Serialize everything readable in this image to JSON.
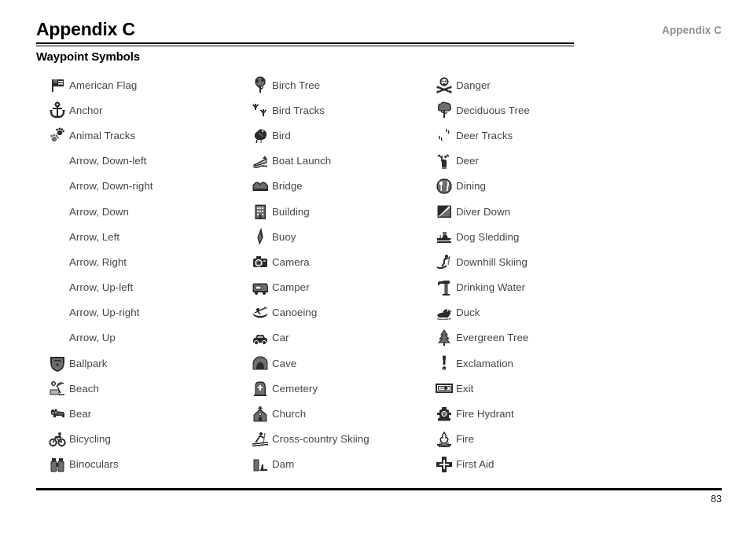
{
  "header": {
    "title": "Appendix C",
    "right_label": "Appendix C",
    "subheading": "Waypoint Symbols"
  },
  "footer": {
    "page_number": "83"
  },
  "columns": [
    {
      "items": [
        {
          "label": "American Flag",
          "icon": "american-flag-icon"
        },
        {
          "label": "Anchor",
          "icon": "anchor-icon"
        },
        {
          "label": "Animal Tracks",
          "icon": "animal-tracks-icon"
        },
        {
          "label": "Arrow, Down-left",
          "icon": "arrow-down-left-icon"
        },
        {
          "label": "Arrow, Down-right",
          "icon": "arrow-down-right-icon"
        },
        {
          "label": "Arrow, Down",
          "icon": "arrow-down-icon"
        },
        {
          "label": "Arrow, Left",
          "icon": "arrow-left-icon"
        },
        {
          "label": "Arrow, Right",
          "icon": "arrow-right-icon"
        },
        {
          "label": "Arrow, Up-left",
          "icon": "arrow-up-left-icon"
        },
        {
          "label": "Arrow, Up-right",
          "icon": "arrow-up-right-icon"
        },
        {
          "label": "Arrow, Up",
          "icon": "arrow-up-icon"
        },
        {
          "label": "Ballpark",
          "icon": "ballpark-icon"
        },
        {
          "label": "Beach",
          "icon": "beach-icon"
        },
        {
          "label": "Bear",
          "icon": "bear-icon"
        },
        {
          "label": "Bicycling",
          "icon": "bicycling-icon"
        },
        {
          "label": "Binoculars",
          "icon": "binoculars-icon"
        }
      ]
    },
    {
      "items": [
        {
          "label": "Birch Tree",
          "icon": "birch-tree-icon"
        },
        {
          "label": "Bird Tracks",
          "icon": "bird-tracks-icon"
        },
        {
          "label": "Bird",
          "icon": "bird-icon"
        },
        {
          "label": "Boat Launch",
          "icon": "boat-launch-icon"
        },
        {
          "label": "Bridge",
          "icon": "bridge-icon"
        },
        {
          "label": "Building",
          "icon": "building-icon"
        },
        {
          "label": "Buoy",
          "icon": "buoy-icon"
        },
        {
          "label": "Camera",
          "icon": "camera-icon"
        },
        {
          "label": "Camper",
          "icon": "camper-icon"
        },
        {
          "label": "Canoeing",
          "icon": "canoeing-icon"
        },
        {
          "label": "Car",
          "icon": "car-icon"
        },
        {
          "label": "Cave",
          "icon": "cave-icon"
        },
        {
          "label": "Cemetery",
          "icon": "cemetery-icon"
        },
        {
          "label": "Church",
          "icon": "church-icon"
        },
        {
          "label": "Cross-country Skiing",
          "icon": "cross-country-skiing-icon"
        },
        {
          "label": "Dam",
          "icon": "dam-icon"
        }
      ]
    },
    {
      "items": [
        {
          "label": "Danger",
          "icon": "danger-icon"
        },
        {
          "label": "Deciduous Tree",
          "icon": "deciduous-tree-icon"
        },
        {
          "label": "Deer Tracks",
          "icon": "deer-tracks-icon"
        },
        {
          "label": "Deer",
          "icon": "deer-icon"
        },
        {
          "label": "Dining",
          "icon": "dining-icon"
        },
        {
          "label": "Diver Down",
          "icon": "diver-down-icon"
        },
        {
          "label": "Dog Sledding",
          "icon": "dog-sledding-icon"
        },
        {
          "label": "Downhill Skiing",
          "icon": "downhill-skiing-icon"
        },
        {
          "label": "Drinking Water",
          "icon": "drinking-water-icon"
        },
        {
          "label": "Duck",
          "icon": "duck-icon"
        },
        {
          "label": "Evergreen Tree",
          "icon": "evergreen-tree-icon"
        },
        {
          "label": "Exclamation",
          "icon": "exclamation-icon"
        },
        {
          "label": "Exit",
          "icon": "exit-icon"
        },
        {
          "label": "Fire Hydrant",
          "icon": "fire-hydrant-icon"
        },
        {
          "label": "Fire",
          "icon": "fire-icon"
        },
        {
          "label": "First Aid",
          "icon": "first-aid-icon"
        }
      ]
    }
  ],
  "colors": {
    "text": "#454545",
    "header_text": "#000000",
    "header_right_text": "#8d8d8d",
    "rule": "#000000",
    "icon_dark": "#2b2b2b",
    "icon_mid": "#6e6e6e",
    "icon_light": "#b4b4b4",
    "background": "#ffffff"
  }
}
